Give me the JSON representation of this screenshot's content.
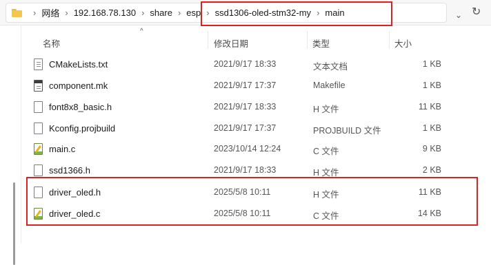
{
  "address": {
    "crumbs": [
      "网络",
      "192.168.78.130",
      "share",
      "esp",
      "ssd1306-oled-stm32-my",
      "main"
    ]
  },
  "columns": {
    "name": "名称",
    "date": "修改日期",
    "type": "类型",
    "size": "大小"
  },
  "files": [
    {
      "name": "CMakeLists.txt",
      "date": "2021/9/17 18:33",
      "type": "文本文档",
      "size": "1 KB",
      "icon": "text-file-icon"
    },
    {
      "name": "component.mk",
      "date": "2021/9/17 17:37",
      "type": "Makefile",
      "size": "1 KB",
      "icon": "makefile-icon"
    },
    {
      "name": "font8x8_basic.h",
      "date": "2021/9/17 18:33",
      "type": "H 文件",
      "size": "11 KB",
      "icon": "header-file-icon"
    },
    {
      "name": "Kconfig.projbuild",
      "date": "2021/9/17 17:37",
      "type": "PROJBUILD 文件",
      "size": "1 KB",
      "icon": "generic-file-icon"
    },
    {
      "name": "main.c",
      "date": "2023/10/14 12:24",
      "type": "C 文件",
      "size": "9 KB",
      "icon": "c-file-icon"
    },
    {
      "name": "ssd1366.h",
      "date": "2021/9/17 18:33",
      "type": "H 文件",
      "size": "2 KB",
      "icon": "header-file-icon"
    },
    {
      "name": "driver_oled.h",
      "date": "2025/5/8 10:11",
      "type": "H 文件",
      "size": "11 KB",
      "icon": "header-file-icon"
    },
    {
      "name": "driver_oled.c",
      "date": "2025/5/8 10:11",
      "type": "C 文件",
      "size": "14 KB",
      "icon": "c-file-icon"
    }
  ],
  "colors": {
    "annotation": "#e02020",
    "folder": "#f6c64a"
  }
}
